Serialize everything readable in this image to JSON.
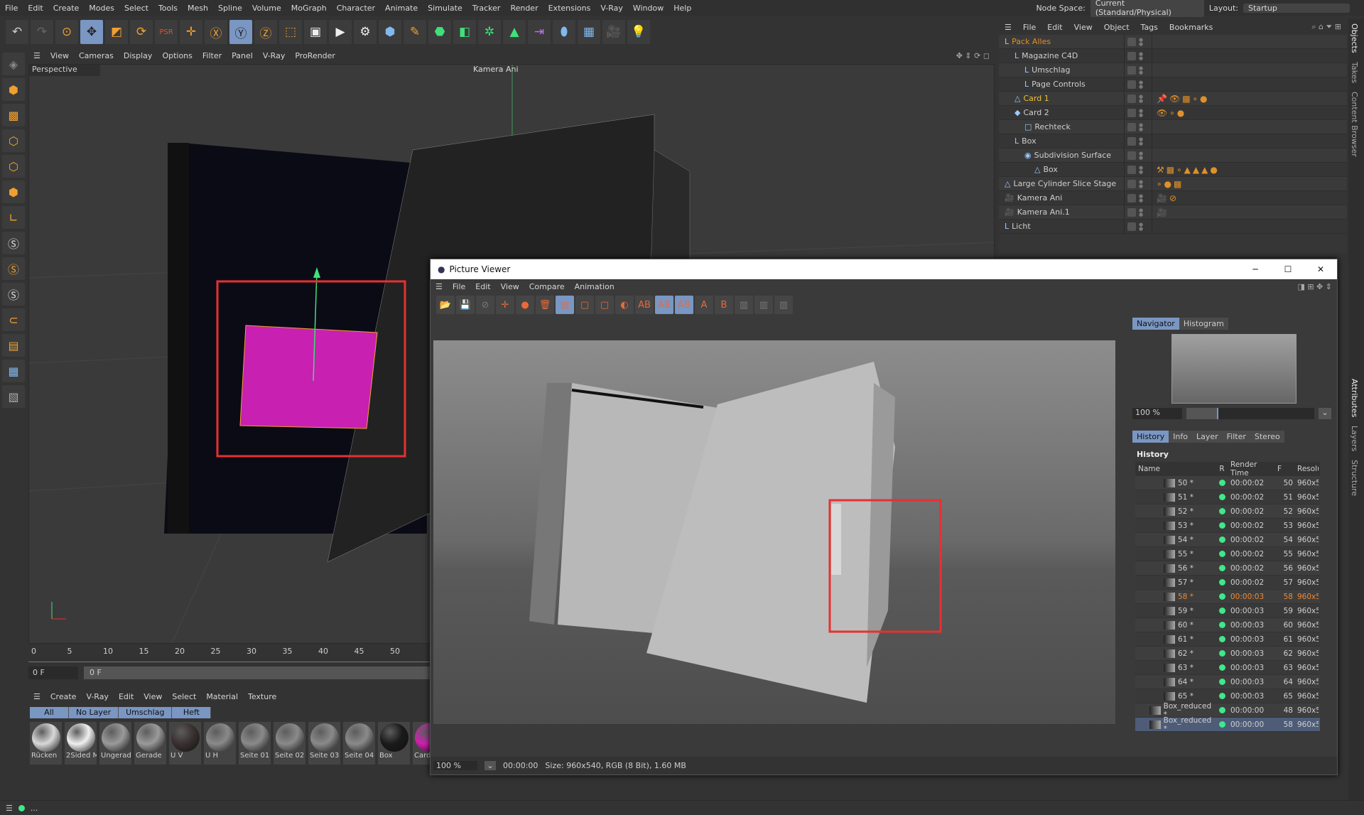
{
  "menubar": [
    "File",
    "Edit",
    "Create",
    "Modes",
    "Select",
    "Tools",
    "Mesh",
    "Spline",
    "Volume",
    "MoGraph",
    "Character",
    "Animate",
    "Simulate",
    "Tracker",
    "Render",
    "Extensions",
    "V-Ray",
    "Window",
    "Help"
  ],
  "node_space": {
    "label": "Node Space:",
    "value": "Current (Standard/Physical)"
  },
  "layout": {
    "label": "Layout:",
    "value": "Startup"
  },
  "viewport": {
    "menu": [
      "View",
      "Cameras",
      "Display",
      "Options",
      "Filter",
      "Panel",
      "V-Ray",
      "ProRender"
    ],
    "name": "Perspective",
    "camera": "Kamera Ani"
  },
  "object_manager": {
    "menu": [
      "File",
      "Edit",
      "View",
      "Object",
      "Tags",
      "Bookmarks"
    ],
    "objects": [
      {
        "name": "Pack Alles",
        "color": "#e0902a"
      },
      {
        "name": "Magazine C4D"
      },
      {
        "name": "Umschlag"
      },
      {
        "name": "Page Controls"
      },
      {
        "name": "Card 1",
        "color": "#f0c030"
      },
      {
        "name": "Card 2"
      },
      {
        "name": "Rechteck"
      },
      {
        "name": "Box"
      },
      {
        "name": "Subdivision Surface"
      },
      {
        "name": "Box"
      },
      {
        "name": "Large Cylinder Slice Stage"
      },
      {
        "name": "Kamera Ani"
      },
      {
        "name": "Kamera Ani.1"
      },
      {
        "name": "Licht"
      }
    ]
  },
  "side_tabs": [
    "Objects",
    "Takes",
    "Content Browser",
    "Attributes",
    "Layers",
    "Structure"
  ],
  "picture_viewer": {
    "title": "Picture Viewer",
    "menu": [
      "File",
      "Edit",
      "View",
      "Compare",
      "Animation"
    ],
    "nav_tabs": [
      "Navigator",
      "Histogram"
    ],
    "zoom": "100 %",
    "tabs": [
      "History",
      "Info",
      "Layer",
      "Filter",
      "Stereo"
    ],
    "history_title": "History",
    "columns": [
      "Name",
      "R",
      "Render Time",
      "F",
      "Resolu"
    ],
    "history": [
      {
        "name": "50 *",
        "time": "00:00:02",
        "f": "50",
        "res": "960x5"
      },
      {
        "name": "51 *",
        "time": "00:00:02",
        "f": "51",
        "res": "960x5"
      },
      {
        "name": "52 *",
        "time": "00:00:02",
        "f": "52",
        "res": "960x5"
      },
      {
        "name": "53 *",
        "time": "00:00:02",
        "f": "53",
        "res": "960x5"
      },
      {
        "name": "54 *",
        "time": "00:00:02",
        "f": "54",
        "res": "960x5"
      },
      {
        "name": "55 *",
        "time": "00:00:02",
        "f": "55",
        "res": "960x5"
      },
      {
        "name": "56 *",
        "time": "00:00:02",
        "f": "56",
        "res": "960x5"
      },
      {
        "name": "57 *",
        "time": "00:00:02",
        "f": "57",
        "res": "960x5"
      },
      {
        "name": "58 *",
        "time": "00:00:03",
        "f": "58",
        "res": "960x5"
      },
      {
        "name": "59 *",
        "time": "00:00:03",
        "f": "59",
        "res": "960x5"
      },
      {
        "name": "60 *",
        "time": "00:00:03",
        "f": "60",
        "res": "960x5"
      },
      {
        "name": "61 *",
        "time": "00:00:03",
        "f": "61",
        "res": "960x5"
      },
      {
        "name": "62 *",
        "time": "00:00:03",
        "f": "62",
        "res": "960x5"
      },
      {
        "name": "63 *",
        "time": "00:00:03",
        "f": "63",
        "res": "960x5"
      },
      {
        "name": "64 *",
        "time": "00:00:03",
        "f": "64",
        "res": "960x5"
      },
      {
        "name": "65 *",
        "time": "00:00:03",
        "f": "65",
        "res": "960x5"
      },
      {
        "name": "Box_reduced *",
        "time": "00:00:00",
        "f": "48",
        "res": "960x5"
      },
      {
        "name": "Box_reduced *",
        "time": "00:00:00",
        "f": "58",
        "res": "960x5"
      }
    ],
    "status": {
      "zoom": "100 %",
      "time": "00:00:00",
      "info": "Size: 960x540, RGB (8 Bit), 1.60 MB"
    }
  },
  "timeline": {
    "ticks": [
      "0",
      "5",
      "10",
      "15",
      "20",
      "25",
      "30",
      "35",
      "40",
      "45",
      "50"
    ],
    "frame": "0 F",
    "frame_end": "0 F"
  },
  "materials": {
    "menu": [
      "Create",
      "V-Ray",
      "Edit",
      "View",
      "Select",
      "Material",
      "Texture"
    ],
    "layers": [
      "All",
      "No Layer",
      "Umschlag",
      "Heft"
    ],
    "items": [
      {
        "name": "Rücken",
        "color": "#d8d8d8"
      },
      {
        "name": "2Sided M",
        "color": "#f0f0f0"
      },
      {
        "name": "Ungerad",
        "color": "#9a9a9a"
      },
      {
        "name": "Gerade",
        "color": "#9a9a9a"
      },
      {
        "name": "U V",
        "color": "#3a3030"
      },
      {
        "name": "U H",
        "color": "#8a8a8a"
      },
      {
        "name": "Seite 01",
        "color": "#8a8a8a"
      },
      {
        "name": "Seite 02",
        "color": "#8a8a8a"
      },
      {
        "name": "Seite 03",
        "color": "#8a8a8a"
      },
      {
        "name": "Seite 04",
        "color": "#8a8a8a"
      },
      {
        "name": "Box",
        "color": "#1a1a1a"
      },
      {
        "name": "Card",
        "color": "#d020b0"
      }
    ]
  },
  "statusbar": {
    "text": "..."
  }
}
